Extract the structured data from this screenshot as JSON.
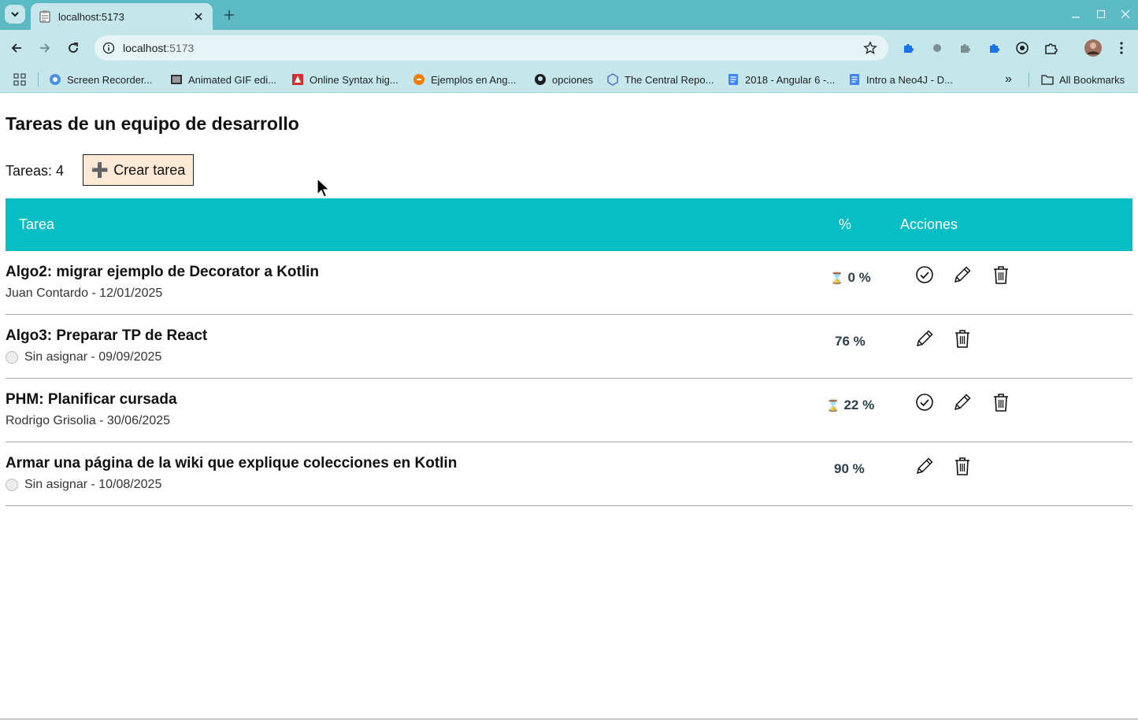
{
  "browser": {
    "tab_title": "localhost:5173",
    "url_host": "localhost",
    "url_port": ":5173",
    "bookmarks": [
      {
        "label": "Screen Recorder...",
        "icon": "screen-recorder-icon"
      },
      {
        "label": "Animated GIF edi...",
        "icon": "gif-editor-icon"
      },
      {
        "label": "Online Syntax hig...",
        "icon": "syntax-highlighter-icon"
      },
      {
        "label": "Ejemplos en Ang...",
        "icon": "angular-examples-icon"
      },
      {
        "label": "opciones",
        "icon": "github-icon"
      },
      {
        "label": "The Central Repo...",
        "icon": "central-repo-icon"
      },
      {
        "label": "2018 - Angular 6 -...",
        "icon": "docs-icon"
      },
      {
        "label": "Intro a Neo4J - D...",
        "icon": "docs-icon"
      }
    ],
    "more_bookmarks": "»",
    "all_bookmarks": "All Bookmarks"
  },
  "page": {
    "title": "Tareas de un equipo de desarrollo",
    "count_label": "Tareas: 4",
    "create_plus": "➕",
    "create_label": "Crear tarea"
  },
  "table": {
    "headers": {
      "task": "Tarea",
      "pct": "%",
      "actions": "Acciones"
    },
    "rows": [
      {
        "title": "Algo2: migrar ejemplo de Decorator a Kotlin",
        "subtitle": "Juan Contardo - 12/01/2025",
        "assigned": true,
        "hourglass": "⌛",
        "pct": "0 %",
        "in_progress": true
      },
      {
        "title": "Algo3: Preparar TP de React",
        "subtitle": "Sin asignar - 09/09/2025",
        "assigned": false,
        "hourglass": "",
        "pct": "76 %",
        "in_progress": false
      },
      {
        "title": "PHM: Planificar cursada",
        "subtitle": "Rodrigo Grisolia - 30/06/2025",
        "assigned": true,
        "hourglass": "⌛",
        "pct": "22 %",
        "in_progress": true
      },
      {
        "title": "Armar una página de la wiki que explique colecciones en Kotlin",
        "subtitle": "Sin asignar - 10/08/2025",
        "assigned": false,
        "hourglass": "",
        "pct": "90 %",
        "in_progress": false
      }
    ]
  },
  "colors": {
    "header_bg": "#07bec4",
    "create_btn_bg": "#fde9d6",
    "chrome": "#c5e7eb",
    "tabstrip": "#5bbac4"
  }
}
